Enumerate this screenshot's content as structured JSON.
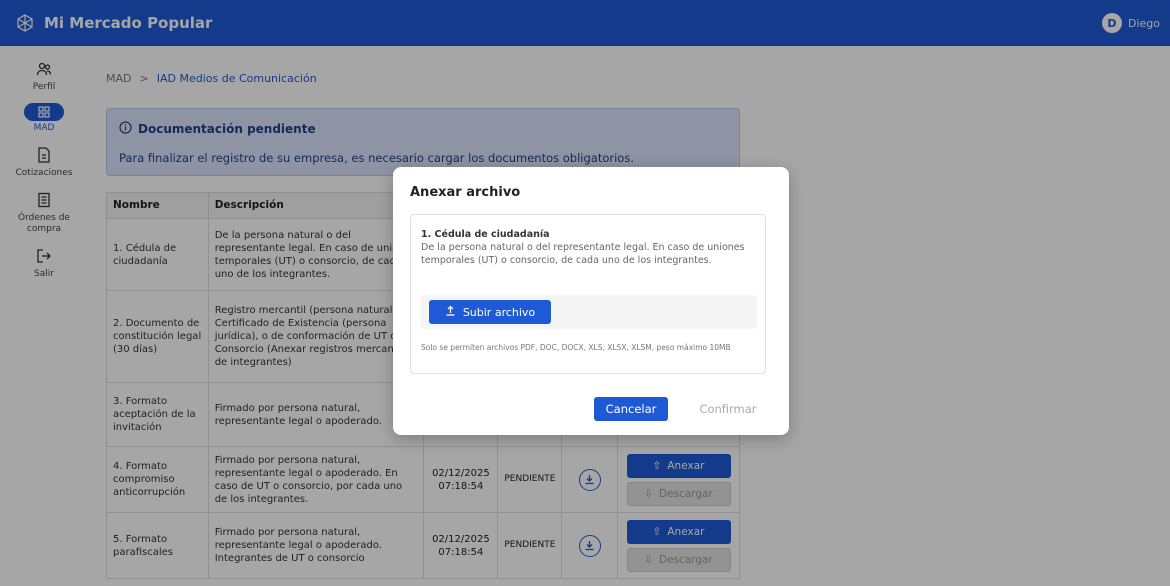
{
  "app": {
    "title": "Mi Mercado Popular",
    "logo_icon": "network-globe-icon"
  },
  "user": {
    "initial": "D",
    "name": "Diego"
  },
  "sidebar": {
    "items": [
      {
        "label": "Perfil",
        "icon": "users-icon",
        "active": false
      },
      {
        "label": "MAD",
        "icon": "grid-icon",
        "active": true
      },
      {
        "label": "Cotizaciones",
        "icon": "document-icon",
        "active": false
      },
      {
        "label": "Órdenes de compra",
        "icon": "list-icon",
        "active": false
      },
      {
        "label": "Salir",
        "icon": "logout-icon",
        "active": false
      }
    ]
  },
  "breadcrumb": {
    "root": "MAD",
    "separator": ">",
    "current": "IAD Medios de Comunicación"
  },
  "alert": {
    "title": "Documentación pendiente",
    "text": "Para finalizar el registro de su empresa, es necesario cargar los documentos obligatorios."
  },
  "table": {
    "headers": {
      "name": "Nombre",
      "description": "Descripción"
    },
    "rows": [
      {
        "name": "1. Cédula de ciudadanía",
        "description": "De la persona natural o del representante legal. En caso de uniones temporales (UT) o consorcio, de cada uno de los integrantes.",
        "date": "",
        "status": "",
        "anexar": "",
        "descargar": ""
      },
      {
        "name": "2. Documento de constitución legal (30 días)",
        "description": "Registro mercantil (persona natural) o Certificado de Existencia (persona jurídica), o de conformación de UT o Consorcio (Anexar registros mercantiles de integrantes)",
        "date": "",
        "status": "",
        "anexar": "",
        "descargar": ""
      },
      {
        "name": "3. Formato aceptación de la invitación",
        "description": "Firmado por persona natural, representante legal o apoderado.",
        "date": "",
        "status": "",
        "anexar": "",
        "descargar": ""
      },
      {
        "name": "4. Formato compromiso anticorrupción",
        "description": "Firmado por persona natural, representante legal o apoderado. En caso de UT o consorcio, por cada uno de los integrantes.",
        "date": "02/12/2025 07:18:54",
        "status": "PENDIENTE",
        "anexar": "Anexar",
        "descargar": "Descargar"
      },
      {
        "name": "5. Formato parafiscales",
        "description": "Firmado por persona natural, representante legal o apoderado. Integrantes de UT o consorcio",
        "date": "02/12/2025 07:18:54",
        "status": "PENDIENTE",
        "anexar": "Anexar",
        "descargar": "Descargar"
      }
    ]
  },
  "modal": {
    "title": "Anexar archivo",
    "doc_title": "1. Cédula de ciudadanía",
    "doc_desc": "De la persona natural o del representante legal. En caso de uniones temporales (UT) o consorcio, de cada uno de los integrantes.",
    "upload_label": "Subir archivo",
    "note": "Solo se permiten archivos PDF, DOC, DOCX, XLS, XLSX, XLSM, peso máximo 10MB",
    "cancel_label": "Cancelar",
    "confirm_label": "Confirmar"
  },
  "colors": {
    "primary": "#1f5ad6",
    "alert_bg": "#dbe4fb"
  }
}
